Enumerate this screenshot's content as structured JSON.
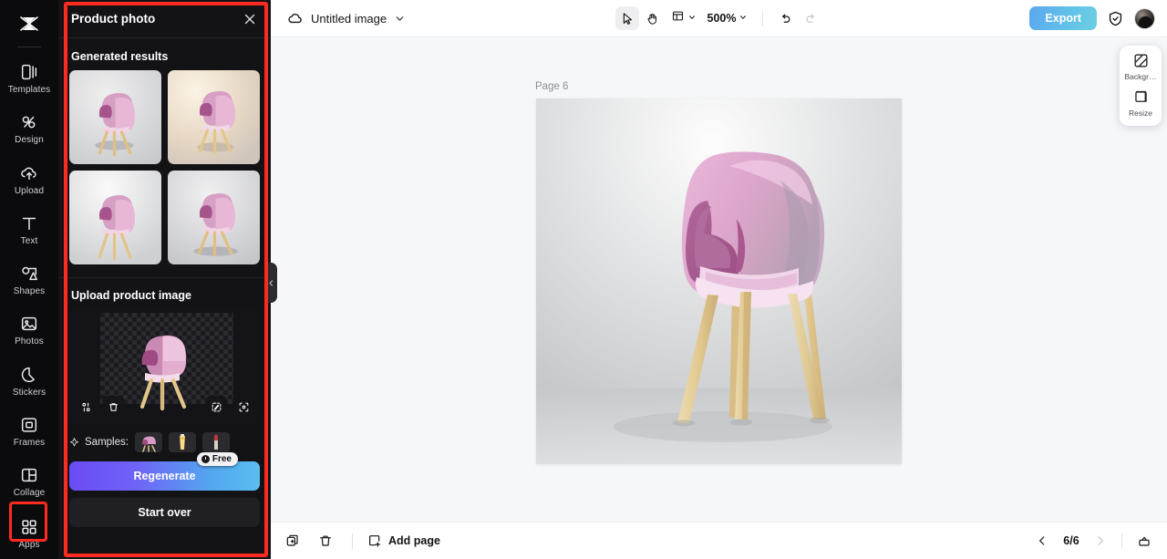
{
  "sidebar": {
    "logo_icon": "capcut-logo-icon",
    "items": [
      {
        "label": "Templates",
        "icon": "templates-icon"
      },
      {
        "label": "Design",
        "icon": "design-icon"
      },
      {
        "label": "Upload",
        "icon": "upload-cloud-icon"
      },
      {
        "label": "Text",
        "icon": "text-icon"
      },
      {
        "label": "Shapes",
        "icon": "shapes-icon"
      },
      {
        "label": "Photos",
        "icon": "photos-icon"
      },
      {
        "label": "Stickers",
        "icon": "stickers-icon"
      },
      {
        "label": "Frames",
        "icon": "frames-icon"
      },
      {
        "label": "Collage",
        "icon": "collage-icon"
      },
      {
        "label": "Apps",
        "icon": "apps-grid-icon"
      }
    ],
    "highlighted_item": "Apps",
    "highlight_color": "#ff2b20"
  },
  "panel": {
    "title": "Product photo",
    "close_icon": "close-icon",
    "collapse_icon": "chevron-left-icon",
    "generated_results": {
      "heading": "Generated results",
      "items": [
        {
          "name": "result-1",
          "background": "#d6d7d9"
        },
        {
          "name": "result-2",
          "background": "#e8dccd"
        },
        {
          "name": "result-3",
          "background": "#e3e4e5"
        },
        {
          "name": "result-4",
          "background": "#d4d5d7"
        }
      ]
    },
    "upload": {
      "heading": "Upload product image",
      "tools": [
        {
          "name": "replace-image-icon",
          "title": "Replace"
        },
        {
          "name": "delete-icon",
          "title": "Delete"
        },
        {
          "name": "magic-edit-icon",
          "title": "Edit"
        },
        {
          "name": "expand-icon",
          "title": "Expand"
        }
      ]
    },
    "samples": {
      "label": "Samples:",
      "sparkle_icon": "sparkle-icon",
      "items": [
        {
          "name": "sample-chair"
        },
        {
          "name": "sample-drink"
        },
        {
          "name": "sample-lipstick"
        }
      ]
    },
    "free_badge": {
      "label": "Free",
      "icon": "coin-icon"
    },
    "regenerate_label": "Regenerate",
    "start_over_label": "Start over",
    "accent_gradient_start": "#6b4bf5",
    "accent_gradient_end": "#59bdf0"
  },
  "topbar": {
    "cloud_icon": "cloud-save-icon",
    "doc_name": "Untitled image",
    "doc_chevron_icon": "chevron-down-icon",
    "tools": [
      {
        "name": "cursor-tool",
        "icon": "cursor-icon",
        "active": true
      },
      {
        "name": "hand-tool",
        "icon": "hand-icon",
        "active": false
      }
    ],
    "view_icon": "page-view-icon",
    "view_chevron_icon": "chevron-down-icon",
    "zoom_level": "500%",
    "zoom_chevron_icon": "chevron-down-icon",
    "undo_icon": "undo-icon",
    "redo_icon": "redo-icon",
    "export_label": "Export",
    "shield_icon": "shield-check-icon",
    "avatar": "user-avatar"
  },
  "canvas": {
    "page_label": "Page 6",
    "artboard_name": "product-photo-artboard"
  },
  "float_tools": [
    {
      "label": "Backgr…",
      "icon": "background-icon",
      "name": "background-tool"
    },
    {
      "label": "Resize",
      "icon": "resize-icon",
      "name": "resize-tool"
    }
  ],
  "bottombar": {
    "duplicate_icon": "duplicate-page-icon",
    "delete_icon": "delete-page-icon",
    "add_page_label": "Add page",
    "add_page_icon": "add-page-icon",
    "prev_icon": "chevron-left-icon",
    "next_icon": "chevron-right-icon",
    "page_indicator": "6/6",
    "export_icon": "export-tray-icon"
  }
}
